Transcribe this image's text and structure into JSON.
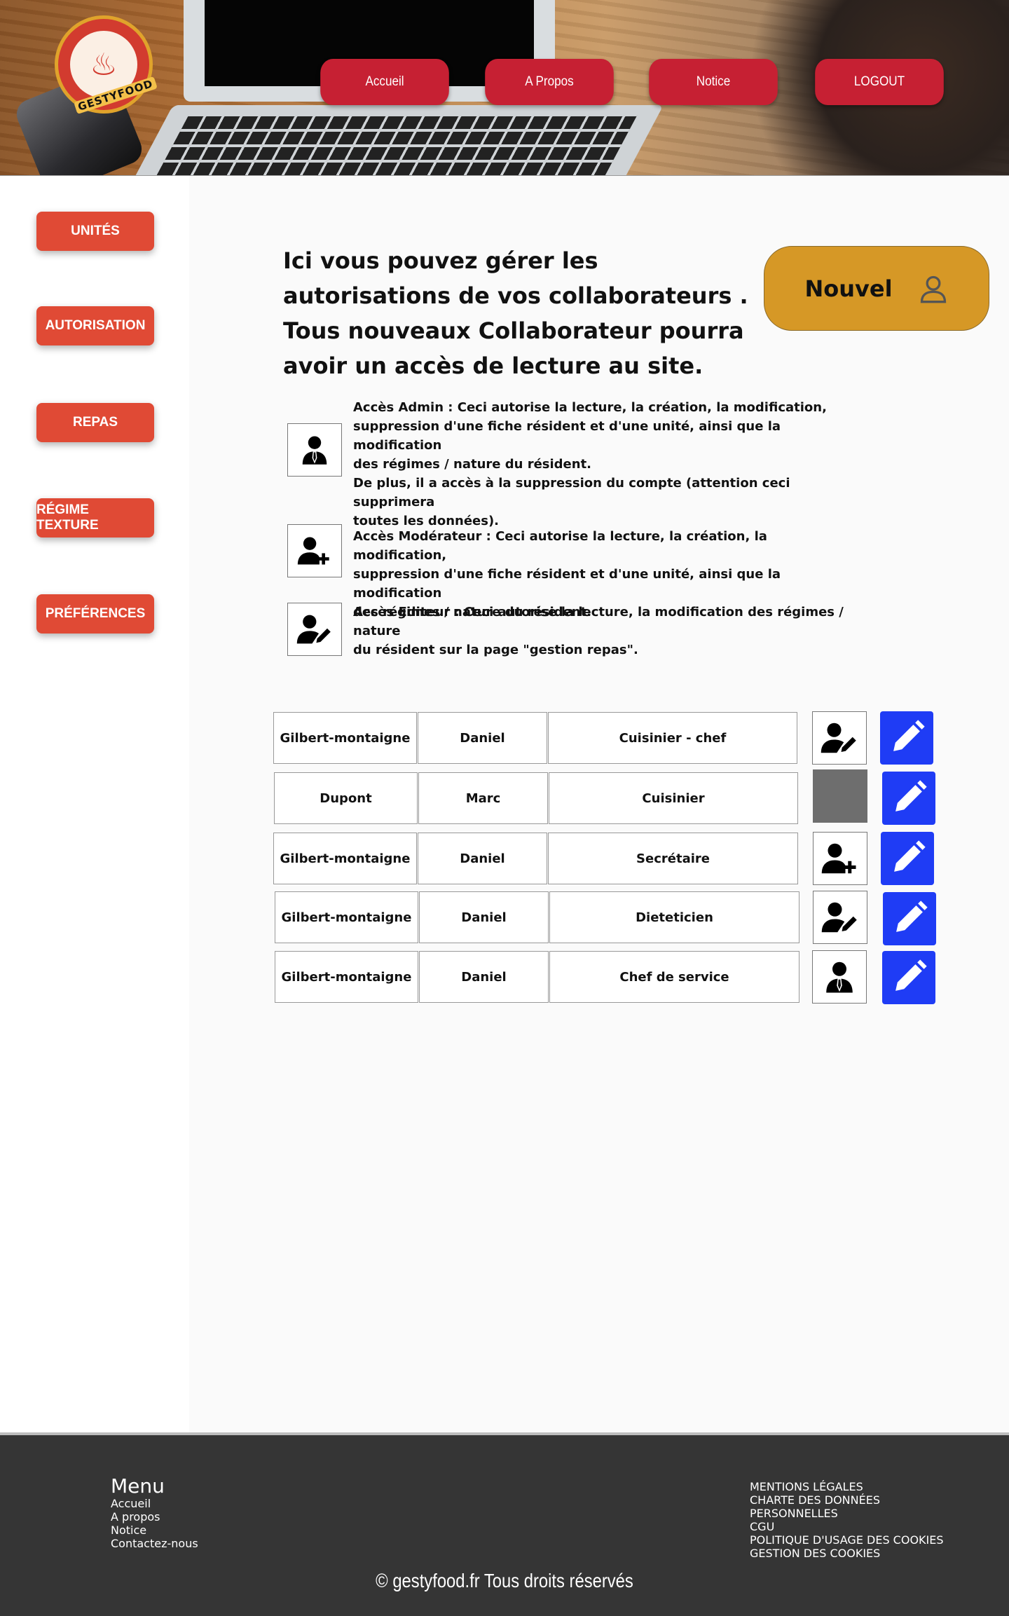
{
  "header": {
    "logo_text": "GESTYFOOD",
    "nav": [
      {
        "label": "Accueil"
      },
      {
        "label": "A Propos"
      },
      {
        "label": "Notice"
      },
      {
        "label": "LOGOUT"
      }
    ]
  },
  "sidebar": {
    "items": [
      {
        "label": "UNITÉS"
      },
      {
        "label": "AUTORISATION"
      },
      {
        "label": "REPAS"
      },
      {
        "label": "RÉGIME TEXTURE"
      },
      {
        "label": "PRÉFÉRENCES"
      }
    ]
  },
  "main": {
    "intro": "Ici vous pouvez gérer les autorisations de vos collaborateurs . Tous nouveaux Collaborateur pourra avoir un accès  de lecture au site.",
    "new_button": {
      "label": "Nouvel",
      "icon": "user-outline-icon"
    },
    "roles": [
      {
        "icon": "user-tie-icon",
        "text": "Accès Admin : Ceci autorise la lecture,  la création, la modification,\nsuppression d'une fiche résident et d'une unité, ainsi que  la modification\ndes régimes / nature du résident.\nDe plus, il a accès à la  suppression du compte (attention ceci supprimera\ntoutes les données)."
      },
      {
        "icon": "user-plus-icon",
        "text": "Accès Modérateur : Ceci autorise la lecture,  la création, la modification,\nsuppression d'une fiche résident et d'une unité, ainsi que  la modification\ndes régimes / nature du résident."
      },
      {
        "icon": "user-pen-icon",
        "text": "Accès Editeur : Ceci autorise la lecture, la modification des régimes / nature\ndu résident sur la page \"gestion  repas\"."
      }
    ],
    "collaborators": [
      {
        "nom": "Gilbert-montaigne",
        "prenom": "Daniel",
        "poste": "Cuisinier - chef",
        "access": "user-pen-icon"
      },
      {
        "nom": "Dupont",
        "prenom": "Marc",
        "poste": "Cuisinier",
        "access": "none"
      },
      {
        "nom": "Gilbert-montaigne",
        "prenom": "Daniel",
        "poste": "Secrétaire",
        "access": "user-plus-icon"
      },
      {
        "nom": "Gilbert-montaigne",
        "prenom": "Daniel",
        "poste": "Dieteticien",
        "access": "user-pen-icon"
      },
      {
        "nom": "Gilbert-montaigne",
        "prenom": "Daniel",
        "poste": "Chef de service",
        "access": "user-tie-icon"
      }
    ]
  },
  "footer": {
    "menu_title": "Menu",
    "menu_links": [
      "Accueil",
      "A propos",
      "Notice",
      "Contactez-nous"
    ],
    "legal_links": [
      "MENTIONS LÉGALES",
      "CHARTE DES DONNÉES",
      "PERSONNELLES",
      "CGU",
      "POLITIQUE D'USAGE DES COOKIES",
      "GESTION DES COOKIES"
    ],
    "copyright": "© gestyfood.fr  Tous droits réservés"
  },
  "colors": {
    "nav_red": "#c62033",
    "sidebar_red": "#e04a35",
    "nouvel_gold": "#d69826",
    "edit_blue": "#1f3cf5",
    "footer_bg": "#353535"
  }
}
